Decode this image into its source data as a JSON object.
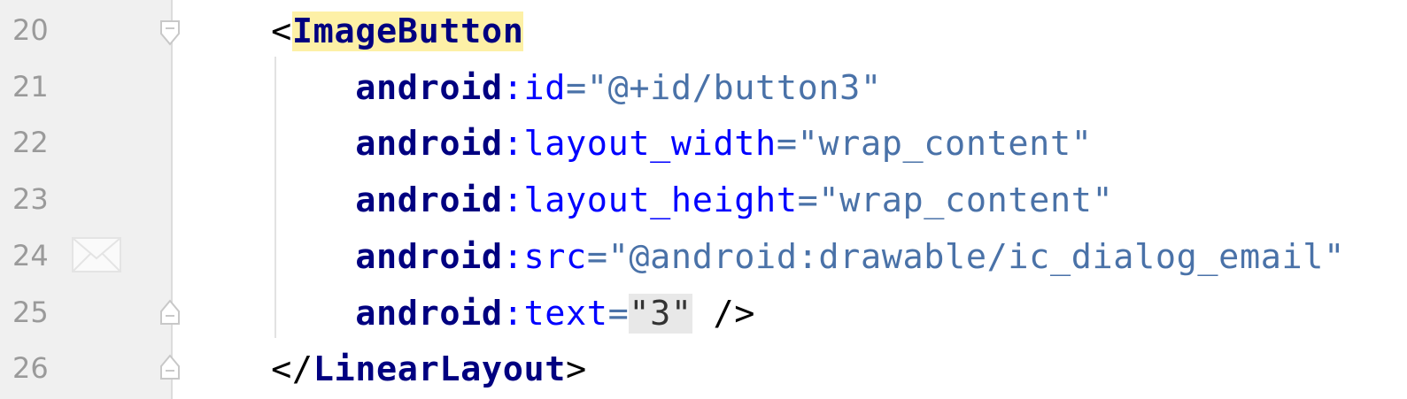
{
  "editor": {
    "lines": [
      {
        "number": "20",
        "lt": "<",
        "tag": "ImageButton"
      },
      {
        "number": "21",
        "ns": "android",
        "attr": ":id",
        "eq": "=",
        "value": "\"@+id/button3\""
      },
      {
        "number": "22",
        "ns": "android",
        "attr": ":layout_width",
        "eq": "=",
        "value": "\"wrap_content\""
      },
      {
        "number": "23",
        "ns": "android",
        "attr": ":layout_height",
        "eq": "=",
        "value": "\"wrap_content\""
      },
      {
        "number": "24",
        "ns": "android",
        "attr": ":src",
        "eq": "=",
        "value": "\"@android:drawable/ic_dialog_email\""
      },
      {
        "number": "25",
        "ns": "android",
        "attr": ":text",
        "eq": "=",
        "value": "\"3\"",
        "end": " />"
      },
      {
        "number": "26",
        "open": "</",
        "tag": "LinearLayout",
        "close": ">"
      }
    ],
    "gutter_icon": "email-icon"
  }
}
